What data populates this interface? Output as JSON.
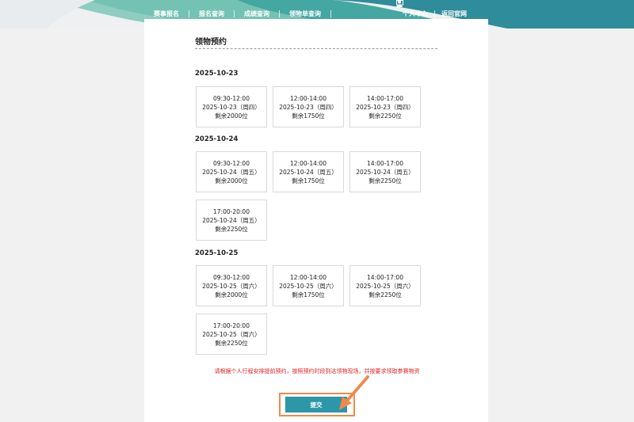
{
  "nav": {
    "left": [
      "赛事报名",
      "报名查询",
      "成绩查询",
      "领物单查询"
    ],
    "personal": "个人中心",
    "official": "返回官网"
  },
  "page": {
    "title": "领物预约",
    "notice": "请根据个人行程安排提前预约，按照预约时段到达领物现场，并按要求领取参赛物资",
    "submit": "提交"
  },
  "days": [
    {
      "date": "2025-10-23",
      "slots": [
        {
          "time": "09:30-12:00",
          "day": "2025-10-23（周四）",
          "remain": "剩余2000位"
        },
        {
          "time": "12:00-14:00",
          "day": "2025-10-23（周四）",
          "remain": "剩余1750位"
        },
        {
          "time": "14:00-17:00",
          "day": "2025-10-23（周四）",
          "remain": "剩余2250位"
        }
      ]
    },
    {
      "date": "2025-10-24",
      "slots": [
        {
          "time": "09:30-12:00",
          "day": "2025-10-24（周五）",
          "remain": "剩余2000位"
        },
        {
          "time": "12:00-14:00",
          "day": "2025-10-24（周五）",
          "remain": "剩余1750位"
        },
        {
          "time": "14:00-17:00",
          "day": "2025-10-24（周五）",
          "remain": "剩余2250位"
        },
        {
          "time": "17:00-20:00",
          "day": "2025-10-24（周五）",
          "remain": "剩余2250位"
        }
      ]
    },
    {
      "date": "2025-10-25",
      "slots": [
        {
          "time": "09:30-12:00",
          "day": "2025-10-25（周六）",
          "remain": "剩余2000位"
        },
        {
          "time": "12:00-14:00",
          "day": "2025-10-25（周六）",
          "remain": "剩余1750位"
        },
        {
          "time": "14:00-17:00",
          "day": "2025-10-25（周六）",
          "remain": "剩余2250位"
        },
        {
          "time": "17:00-20:00",
          "day": "2025-10-25（周六）",
          "remain": "剩余2250位"
        }
      ]
    }
  ],
  "colors": {
    "accent": "#2b97a9",
    "highlight": "#ef8a4a",
    "notice": "#e02020"
  }
}
